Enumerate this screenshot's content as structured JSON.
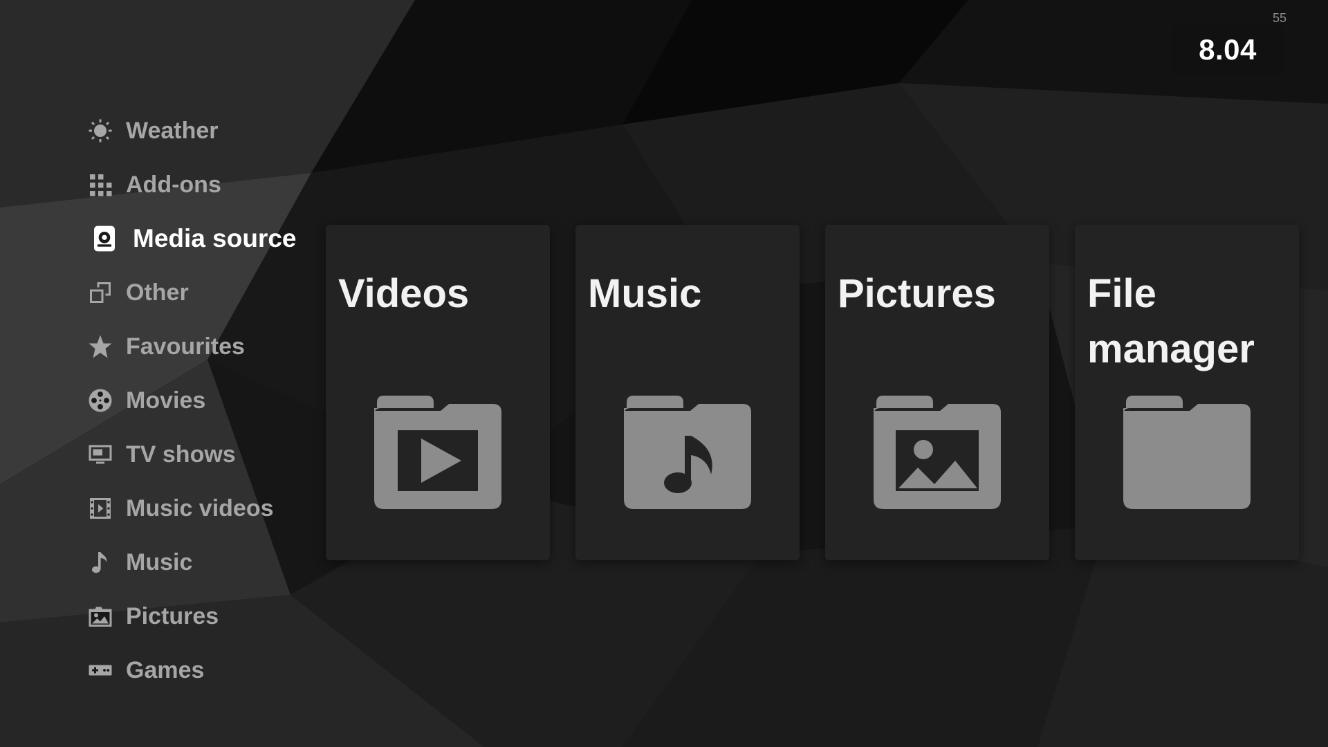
{
  "status": {
    "fps": "55",
    "clock": "8.04"
  },
  "sidebar": {
    "items": [
      {
        "label": "Weather",
        "icon": "sun-icon"
      },
      {
        "label": "Add-ons",
        "icon": "addons-grid-icon"
      },
      {
        "label": "Media source",
        "icon": "media-source-icon",
        "active": true
      },
      {
        "label": "Other",
        "icon": "windows-icon"
      },
      {
        "label": "Favourites",
        "icon": "star-icon"
      },
      {
        "label": "Movies",
        "icon": "film-reel-icon"
      },
      {
        "label": "TV shows",
        "icon": "tv-icon"
      },
      {
        "label": "Music videos",
        "icon": "film-strip-icon"
      },
      {
        "label": "Music",
        "icon": "music-note-icon"
      },
      {
        "label": "Pictures",
        "icon": "pictures-icon"
      },
      {
        "label": "Games",
        "icon": "gamepad-icon"
      }
    ]
  },
  "tiles": [
    {
      "title": "Videos",
      "icon": "folder-video-icon"
    },
    {
      "title": "Music",
      "icon": "folder-music-icon"
    },
    {
      "title": "Pictures",
      "icon": "folder-pictures-icon"
    },
    {
      "title": "File manager",
      "icon": "folder-icon"
    }
  ],
  "colors": {
    "background": "#1a1a1a",
    "tile": "#232323",
    "icon": "#8c8c8c",
    "text_inactive": "#a6a6a6",
    "text_active": "#ffffff"
  }
}
